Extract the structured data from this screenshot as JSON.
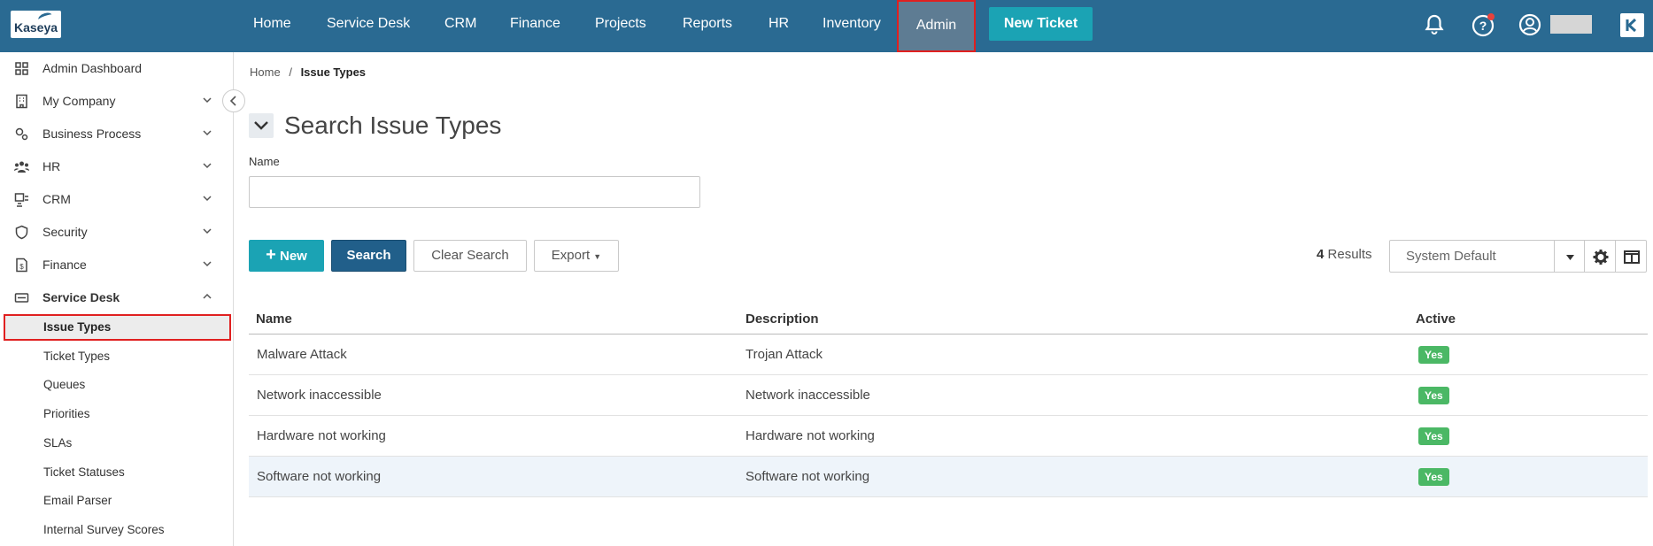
{
  "brand": {
    "logo_text": "Kaseya"
  },
  "topnav": {
    "items": [
      "Home",
      "Service Desk",
      "CRM",
      "Finance",
      "Projects",
      "Reports",
      "HR",
      "Inventory",
      "Admin"
    ],
    "new_ticket": "New Ticket"
  },
  "sidebar": {
    "items": [
      {
        "label": "Admin Dashboard",
        "icon": "grid-icon"
      },
      {
        "label": "My Company",
        "icon": "building-icon"
      },
      {
        "label": "Business Process",
        "icon": "cogs-icon"
      },
      {
        "label": "HR",
        "icon": "people-icon"
      },
      {
        "label": "CRM",
        "icon": "crm-icon"
      },
      {
        "label": "Security",
        "icon": "shield-icon"
      },
      {
        "label": "Finance",
        "icon": "document-dollar-icon"
      },
      {
        "label": "Service Desk",
        "icon": "service-desk-icon"
      }
    ],
    "sub_items": [
      "Issue Types",
      "Ticket Types",
      "Queues",
      "Priorities",
      "SLAs",
      "Ticket Statuses",
      "Email Parser",
      "Internal Survey Scores"
    ],
    "active": "Issue Types"
  },
  "breadcrumb": {
    "home": "Home",
    "sep": "/",
    "current": "Issue Types"
  },
  "page": {
    "title": "Search Issue Types"
  },
  "search": {
    "name_label": "Name",
    "name_value": "",
    "name_placeholder": ""
  },
  "toolbar": {
    "new": "New",
    "search": "Search",
    "clear": "Clear Search",
    "export": "Export"
  },
  "results": {
    "count": "4",
    "label": "Results"
  },
  "view_select": {
    "value": "System Default"
  },
  "table": {
    "headers": [
      "Name",
      "Description",
      "Active"
    ],
    "rows": [
      {
        "name": "Malware Attack",
        "description": "Trojan Attack",
        "active": "Yes"
      },
      {
        "name": "Network inaccessible",
        "description": "Network inaccessible",
        "active": "Yes"
      },
      {
        "name": "Hardware not working",
        "description": "Hardware not working",
        "active": "Yes"
      },
      {
        "name": "Software not working",
        "description": "Software not working",
        "active": "Yes"
      }
    ]
  },
  "colors": {
    "topbar": "#2a6a92",
    "accent": "#1ba3b4",
    "search_btn": "#215f8a",
    "badge_green": "#4bb865",
    "highlight_border": "#e02020"
  }
}
